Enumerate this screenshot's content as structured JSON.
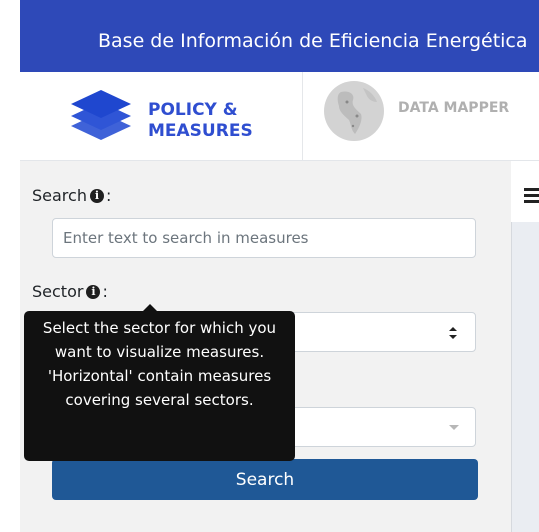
{
  "header": {
    "title": "Base de Información de Eficiencia Energética"
  },
  "tabs": {
    "policy": {
      "label": "POLICY & MEASURES",
      "icon": "layers-icon"
    },
    "mapper": {
      "label": "DATA MAPPER",
      "icon": "globe-icon"
    }
  },
  "search": {
    "label": "Search",
    "label_suffix": ":",
    "placeholder": "Enter text to search in measures"
  },
  "sector": {
    "label": "Sector",
    "label_suffix": ":"
  },
  "tooltip": {
    "text": "Select the sector for which you want to visualize measures. 'Horizontal' contain measures covering several sectors."
  },
  "search_button": {
    "label": "Search"
  },
  "colors": {
    "header_bg": "#2e49b8",
    "accent": "#2f4ed0",
    "button_bg": "#1f5896",
    "tooltip_bg": "#111111"
  }
}
